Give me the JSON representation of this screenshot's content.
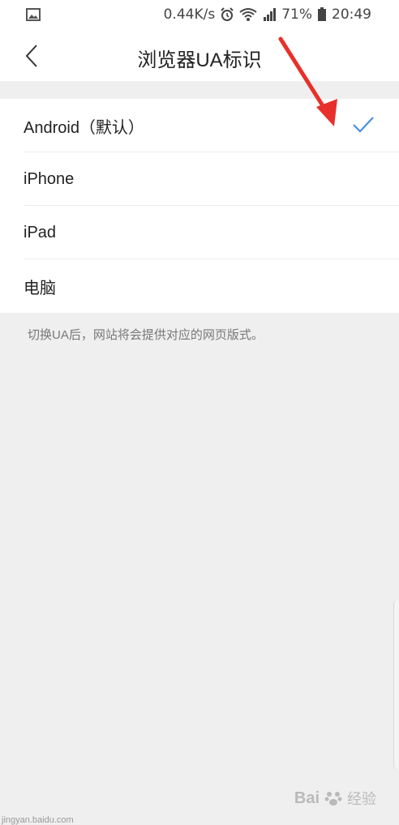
{
  "status_bar": {
    "speed": "0.44K/s",
    "battery": "71%",
    "time": "20:49"
  },
  "header": {
    "title": "浏览器UA标识"
  },
  "ua_options": [
    {
      "label": "Android（默认）",
      "selected": true
    },
    {
      "label": "iPhone",
      "selected": false
    },
    {
      "label": "iPad",
      "selected": false
    },
    {
      "label": "电脑",
      "selected": false
    }
  ],
  "hint": "切换UA后，网站将会提供对应的网页版式。",
  "watermark": {
    "brand": "Bai",
    "suffix": "经验",
    "sub": "jingyan.baidu.com"
  },
  "colors": {
    "accent": "#4a90e2",
    "arrow": "#e8302b"
  },
  "icons": {
    "back": "chevron-left-icon",
    "check": "checkmark-icon",
    "gallery": "image-icon",
    "alarm": "alarm-icon",
    "wifi": "wifi-icon",
    "signal": "signal-icon",
    "battery": "battery-icon"
  }
}
